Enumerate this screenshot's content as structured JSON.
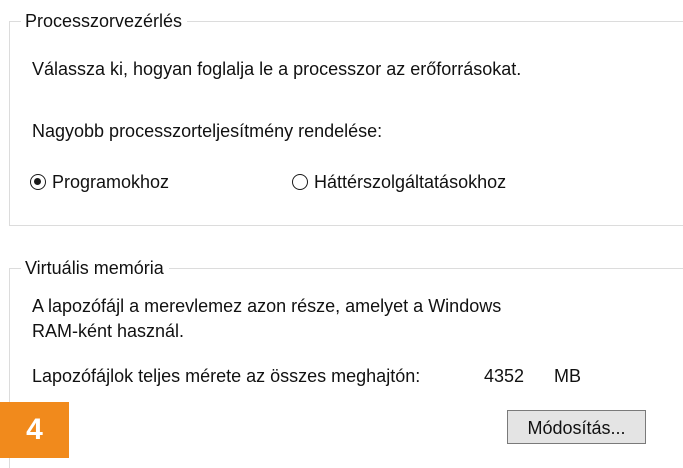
{
  "processor_scheduling": {
    "title": "Processzorvezérlés",
    "description": "Válassza ki, hogyan foglalja le a processzor az erőforrásokat.",
    "adjust_label": "Nagyobb processzorteljesítmény rendelése:",
    "options": [
      {
        "label": "Programokhoz",
        "selected": true
      },
      {
        "label": "Háttérszolgáltatásokhoz",
        "selected": false
      }
    ]
  },
  "virtual_memory": {
    "title": "Virtuális memória",
    "description_line1": "A lapozófájl a merevlemez azon része, amelyet a Windows",
    "description_line2": "RAM-ként használ.",
    "total_label": "Lapozófájlok teljes mérete az összes meghajtón:",
    "total_value": "4352",
    "total_unit": "MB",
    "change_button": "Módosítás..."
  },
  "badge": {
    "number": "4",
    "color": "#f18a1c"
  }
}
